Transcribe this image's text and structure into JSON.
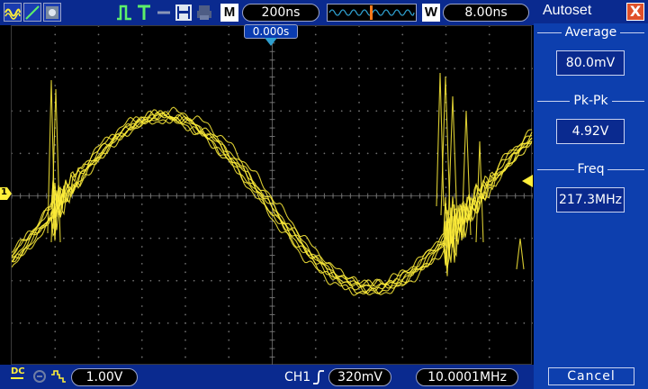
{
  "toolbar": {
    "timebase_letter": "M",
    "timebase": "200ns",
    "window_letter": "W",
    "window": "8.00ns"
  },
  "trigger_marker": {
    "time": "0.000s"
  },
  "channel": {
    "number": "1",
    "coupling": "DC",
    "volts_per_div": "1.00V"
  },
  "status": {
    "trigger_source": "CH1",
    "trigger_level": "320mV",
    "frequency_counter": "10.0001MHz"
  },
  "panel": {
    "title": "Autoset",
    "close": "X",
    "measurements": [
      {
        "label": "Average",
        "value": "80.0mV"
      },
      {
        "label": "Pk-Pk",
        "value": "4.92V"
      },
      {
        "label": "Freq",
        "value": "217.3MHz"
      }
    ],
    "cancel": "Cancel"
  },
  "colors": {
    "trace": "#ffef3a",
    "toolbar": "#0a2a8f",
    "panel": "#0d3fae",
    "grid": "#6e6e6e"
  },
  "icons": {
    "display_modes": [
      "waveform-display-icon",
      "dots-display-icon",
      "persist-display-icon"
    ],
    "run_mode": "trigger-run-icon",
    "trigger": "trigger-t-icon",
    "storage": "floppy-disk-icon",
    "print": "printer-icon"
  }
}
